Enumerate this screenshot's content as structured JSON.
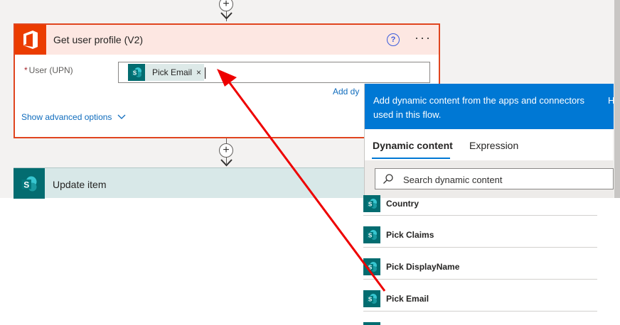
{
  "flow": {
    "step1": {
      "title": "Get user profile (V2)",
      "help_glyph": "?",
      "more_glyph": "···",
      "field_required_mark": "*",
      "field_label": "User (UPN)",
      "token_label": "Pick Email",
      "token_remove": "×",
      "add_dynamic_link": "Add dy",
      "advanced_options": "Show advanced options"
    },
    "step2": {
      "title": "Update item"
    },
    "add_step_glyph": "+"
  },
  "dynamic_panel": {
    "banner_text": "Add dynamic content from the apps and connectors used in this flow.",
    "banner_hide": "H",
    "tabs": [
      {
        "label": "Dynamic content",
        "active": true
      },
      {
        "label": "Expression",
        "active": false
      }
    ],
    "search_placeholder": "Search dynamic content",
    "items": [
      {
        "label": "Country"
      },
      {
        "label": "Pick Claims"
      },
      {
        "label": "Pick DisplayName"
      },
      {
        "label": "Pick Email"
      }
    ]
  },
  "colors": {
    "office_orange": "#eb3c00",
    "card_border": "#e0451f",
    "sharepoint_teal": "#036c70",
    "banner_blue": "#0078d4",
    "annotation_arrow": "#ee0000"
  },
  "icons": [
    "office-icon",
    "sharepoint-icon",
    "help-icon",
    "more-icon",
    "chevron-down-icon",
    "search-icon",
    "plus-icon"
  ]
}
